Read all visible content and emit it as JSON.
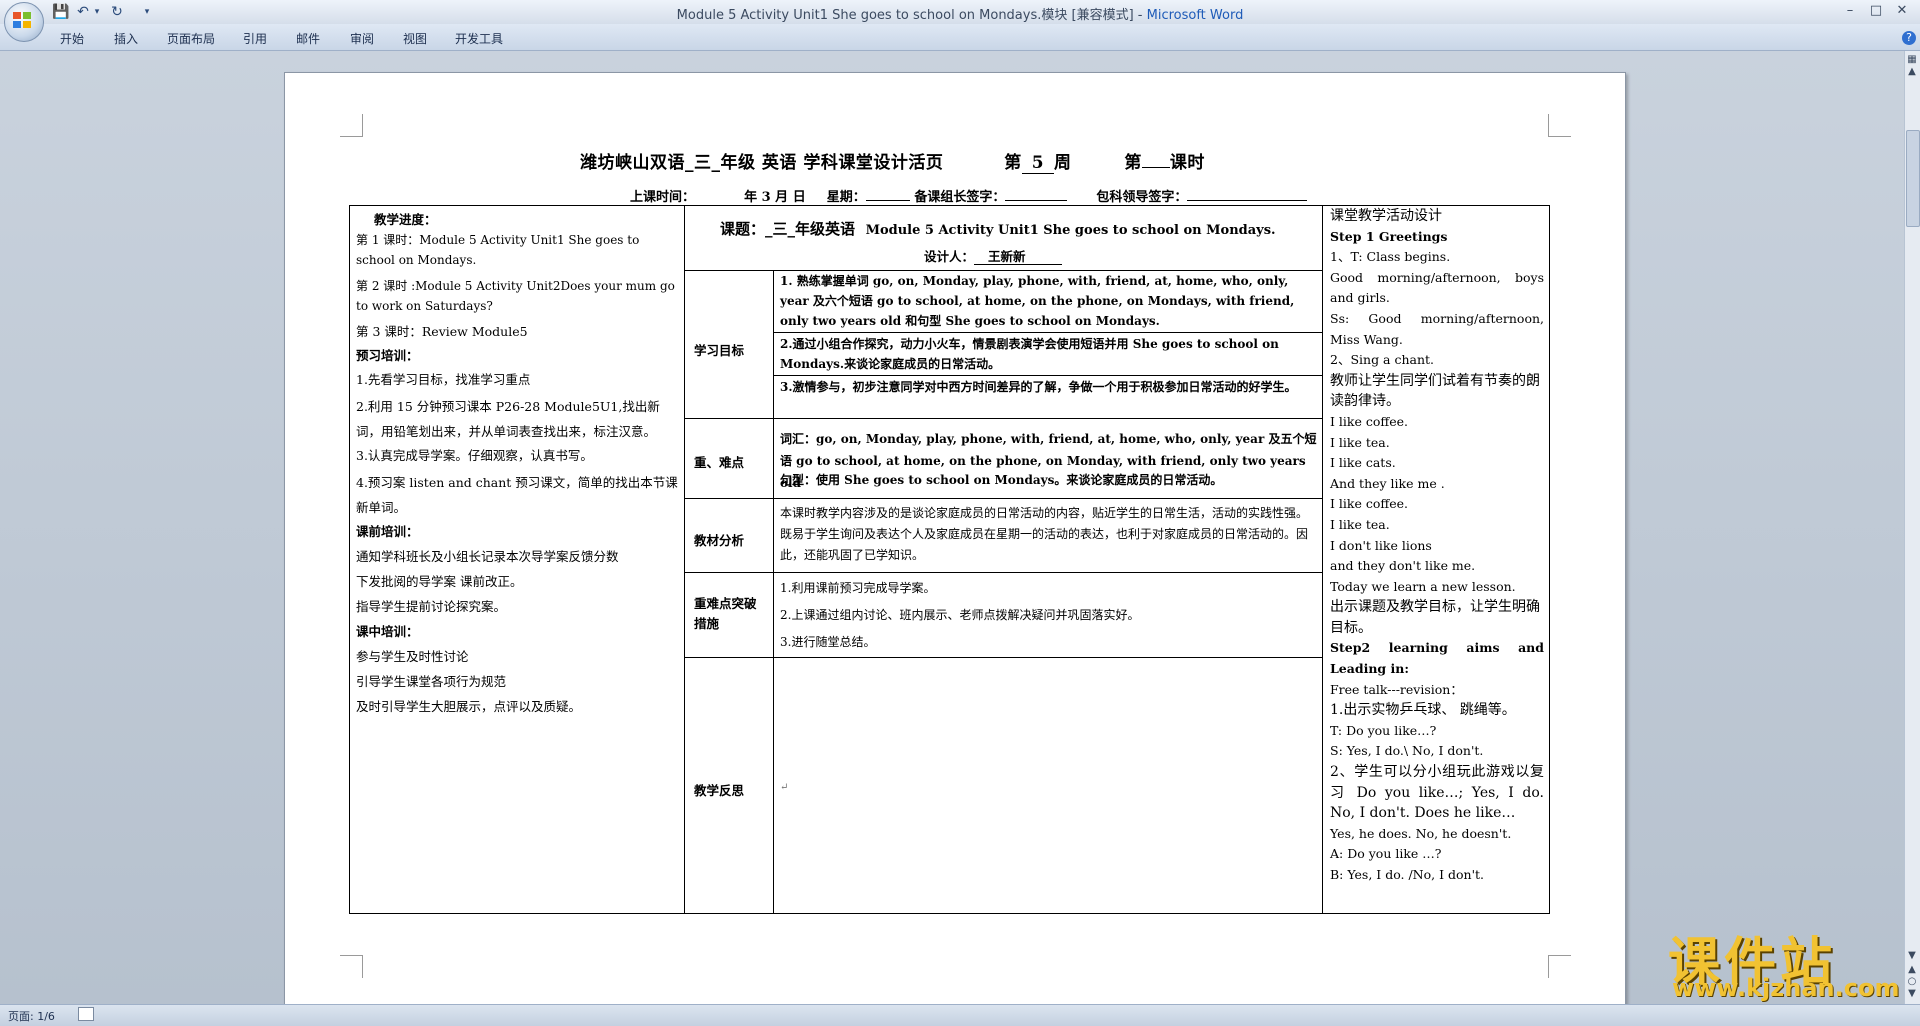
{
  "window": {
    "title": "Module 5 Activity Unit1 She goes to school on Mondays.模块 [兼容模式] - ",
    "app_name": "Microsoft Word",
    "qa_icons": [
      "save-icon",
      "undo-icon",
      "redo-icon",
      "customize-icon"
    ]
  },
  "ribbon": {
    "tabs": [
      "开始",
      "插入",
      "页面布局",
      "引用",
      "邮件",
      "审阅",
      "视图",
      "开发工具"
    ],
    "help": "?"
  },
  "status": {
    "page": "页面: 1/6"
  },
  "document": {
    "header": {
      "school": "潍坊峡山双语_三_年级 英语 学科课堂设计活页",
      "week_label": "第",
      "week_num": "5",
      "week_suffix": "周",
      "period_label": "第",
      "period_suffix": "课时"
    },
    "subheader": {
      "time_label": "上课时间：",
      "date_text": "年 3 月      日",
      "weekday_label": "星期：",
      "leader_label": "备课组长签字：",
      "admin_label": "包科领导签字："
    },
    "left": {
      "progress_label": "教学进度：",
      "p1": "第 1 课时：Module 5 Activity Unit1 She goes to school on Mondays.",
      "p2": "第 2 课时 :Module 5 Activity Unit2Does your mum go to work on Saturdays?",
      "p3": "第 3 课时：Review Module5",
      "preview_label": "预习培训：",
      "pv1": "1.先看学习目标，找准学习重点",
      "pv2": "2.利用 15 分钟预习课本 P26-28 Module5U1,找出新词，用铅笔划出来，并从单词表查找出来，标注汉意。",
      "pv3": "3.认真完成导学案。仔细观察，认真书写。",
      "pv4": "4.预习案 listen and chant 预习课文，简单的找出本节课新单词。",
      "pre_label": "课前培训：",
      "pr1": "通知学科班长及小组长记录本次导学案反馈分数",
      "pr2": "下发批阅的导学案 课前改正。",
      "pr3": "指导学生提前讨论探究案。",
      "in_label": "课中培训：",
      "in1": "参与学生及时性讨论",
      "in2": "引导学生课堂各项行为规范",
      "in3": "及时引导学生大胆展示，点评以及质疑。"
    },
    "middle": {
      "topic_label": "课题：",
      "topic_grade": "_三_年级英语",
      "topic_title": "Module 5 Activity Unit1 She goes to school on Mondays.",
      "designer_label": "设计人：",
      "designer": "王新新",
      "goal_label": "学习目标",
      "goal1": "1. 熟练掌握单词 go, on, Monday, play, phone, with, friend, at, home, who, only, year 及六个短语 go to school, at home, on the phone, on Mondays, with friend, only two years old 和句型 She goes to school on Mondays.",
      "goal2": "2.通过小组合作探究，动力小火车，情景剧表演学会使用短语并用 She goes to school on Mondays.来谈论家庭成员的日常活动。",
      "goal3": "3.激情参与，初步注意同学对中西方时间差异的了解，争做一个用于积极参加日常活动的好学生。",
      "key_label": "重、难点",
      "key1": "词汇：go, on, Monday, play, phone, with, friend, at, home, who, only, year 及五个短语 go to school, at home, on the phone, on Monday, with friend, only two years old",
      "key2": "句型：使用 She goes to school on Mondays。来谈论家庭成员的日常活动。",
      "analysis_label": "教材分析",
      "analysis": "本课时教学内容涉及的是谈论家庭成员的日常活动的内容，贴近学生的日常生活，活动的实践性强。既易于学生询问及表达个人及家庭成员在星期一的活动的表达，也利于对家庭成员的日常活动的。因此，还能巩固了已学知识。",
      "measure_label": "重难点突破措施",
      "m1": "1.利用课前预习完成导学案。",
      "m2": "2.上课通过组内讨论、班内展示、老师点拨解决疑问并巩固落实好。",
      "m3": "3.进行随堂总结。",
      "reflect_label": "教学反思"
    },
    "right": {
      "title": "课堂教学活动设计",
      "step1": "Step 1 Greetings",
      "r1": "1、T: Class begins.",
      "r2": "Good morning/afternoon, boys and girls.",
      "r3": "Ss: Good morning/afternoon, Miss Wang.",
      "r4": "2、Sing a chant.",
      "r5": "教师让学生同学们试着有节奏的朗读韵律诗。",
      "r6": "I like coffee.",
      "r7": "I like tea.",
      "r8": "I like cats.",
      "r9": "And they like me .",
      "r10": "I like coffee.",
      "r11": "I like tea.",
      "r12": "I don't like    lions",
      "r13": "and they don't like me.",
      "r14": "Today we learn a new lesson.",
      "r15": "出示课题及教学目标，让学生明确目标。",
      "step2": "Step2 learning aims and Leading in:",
      "r16": "Free talk---revision：",
      "r17": "1.出示实物乒乓球、 跳绳等。",
      "r18": "T: Do you like…?",
      "r19": "S: Yes, I do.\\ No, I don't.",
      "r20": "2、学生可以分小组玩此游戏以复习 Do you like…; Yes, I do. No, I don't. Does he like…",
      "r21": "Yes, he does. No, he doesn't.",
      "r22": "A: Do you like …?",
      "r23": "B: Yes, I do. /No, I don't."
    }
  },
  "watermark": {
    "text": "课件站",
    "url": "www.kjzhan.com"
  }
}
